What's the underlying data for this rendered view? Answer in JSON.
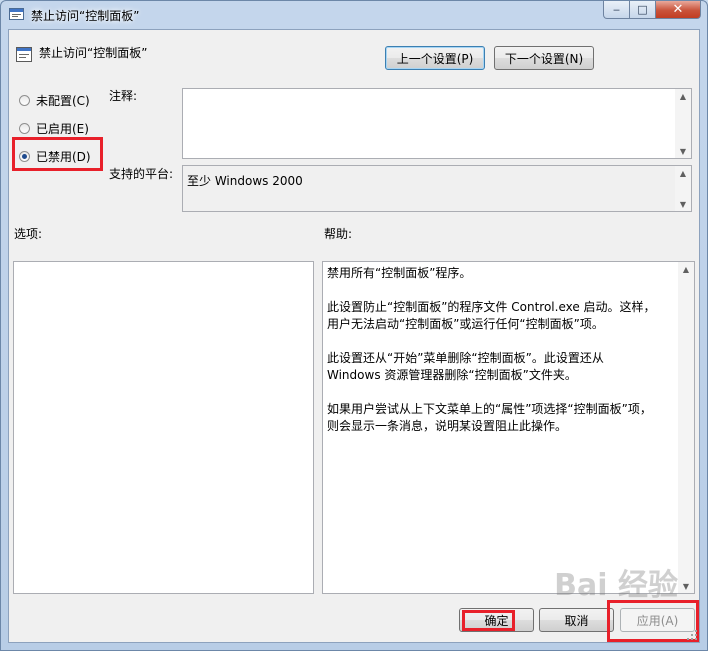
{
  "window": {
    "title": "禁止访问“控制面板”"
  },
  "policy": {
    "name": "禁止访问“控制面板”"
  },
  "nav": {
    "prev_label": "上一个设置(P)",
    "next_label": "下一个设置(N)"
  },
  "state": {
    "options": [
      {
        "label": "未配置(C)",
        "checked": false
      },
      {
        "label": "已启用(E)",
        "checked": false
      },
      {
        "label": "已禁用(D)",
        "checked": true
      }
    ]
  },
  "comment": {
    "label": "注释:",
    "value": ""
  },
  "platform": {
    "label": "支持的平台:",
    "value": "至少 Windows 2000"
  },
  "options_section": {
    "label": "选项:"
  },
  "help": {
    "label": "帮助:",
    "paragraphs": [
      "禁用所有“控制面板”程序。",
      "此设置防止“控制面板”的程序文件 Control.exe 启动。这样，\n用户无法启动“控制面板”或运行任何“控制面板”项。",
      "此设置还从“开始”菜单删除“控制面板”。此设置还从\nWindows 资源管理器删除“控制面板”文件夹。",
      "如果用户尝试从上下文菜单上的“属性”项选择“控制面板”项，\n则会显示一条消息，说明某设置阻止此操作。"
    ]
  },
  "footer": {
    "ok_label": "确定",
    "cancel_label": "取消",
    "apply_label": "应用(A)"
  },
  "watermark": "Bai 经验",
  "colors": {
    "highlight": "#e8202a",
    "accent": "#1e4a8e"
  }
}
